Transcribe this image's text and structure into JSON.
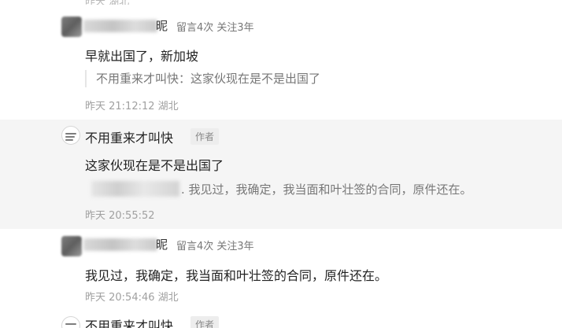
{
  "comments": [
    {
      "id": "c1",
      "user": {
        "name_tail": "昵",
        "badge": "留言4次 关注3年"
      },
      "text": "早就出国了，新加坡",
      "quote": "不用重来才叫快：这家伙现在是不是出国了",
      "time": "昨天 21:12:12",
      "location": "湖北"
    },
    {
      "id": "c2",
      "user": {
        "name": "不用重来才叫快",
        "tag": "作者"
      },
      "text": "这家伙现在是不是出国了",
      "quote_tail": ". 我见过，我确定，我当面和叶壮签的合同，原件还在。",
      "time": "昨天 20:55:52",
      "location": ""
    },
    {
      "id": "c3",
      "user": {
        "name_tail": "昵",
        "badge": "留言4次 关注3年"
      },
      "text": "我见过，我确定，我当面和叶壮签的合同，原件还在。",
      "time": "昨天 20:54:46",
      "location": "湖北"
    },
    {
      "id": "c4",
      "user": {
        "name": "不用重来才叫快",
        "tag": "作者"
      }
    }
  ],
  "colors": {
    "highlight_bg": "#f5f5f5",
    "meta_text": "#a0a0a0",
    "quote_border": "#e5e5e5"
  },
  "icons": {
    "author_avatar": "logo-avatar",
    "user_avatar": "blurred-avatar"
  }
}
